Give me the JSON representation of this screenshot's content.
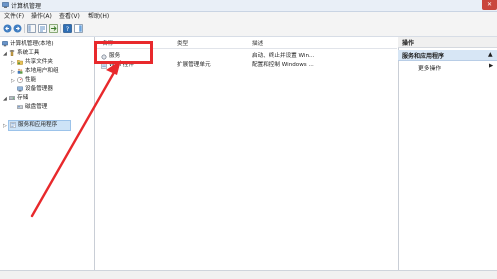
{
  "window": {
    "title": "计算机管理",
    "close_glyph": "✕"
  },
  "menu": {
    "items": [
      "文件(F)",
      "操作(A)",
      "查看(V)",
      "帮助(H)"
    ]
  },
  "tree": {
    "items": [
      {
        "label": "计算机管理(本地)"
      },
      {
        "label": "系统工具"
      },
      {
        "label": "共享文件夹"
      },
      {
        "label": "本地用户和组"
      },
      {
        "label": "性能"
      },
      {
        "label": "设备管理器"
      },
      {
        "label": "存储"
      },
      {
        "label": "磁盘管理"
      },
      {
        "label": "服务和应用程序"
      }
    ]
  },
  "list": {
    "headers": {
      "name": "名称",
      "type": "类型",
      "description": "描述"
    },
    "rows": [
      {
        "name": "服务",
        "type": "",
        "description": "启动、终止并设置 Win..."
      },
      {
        "name": "WMI 控件",
        "type": "扩展管理单元",
        "description": "配置和控制 Windows ..."
      }
    ]
  },
  "actions": {
    "header": "操作",
    "section": "服务和应用程序",
    "more": "更多操作"
  },
  "colors": {
    "annotation": "#e8292c",
    "selection": "#cde3f7",
    "titlebar": "#e9eff7"
  }
}
